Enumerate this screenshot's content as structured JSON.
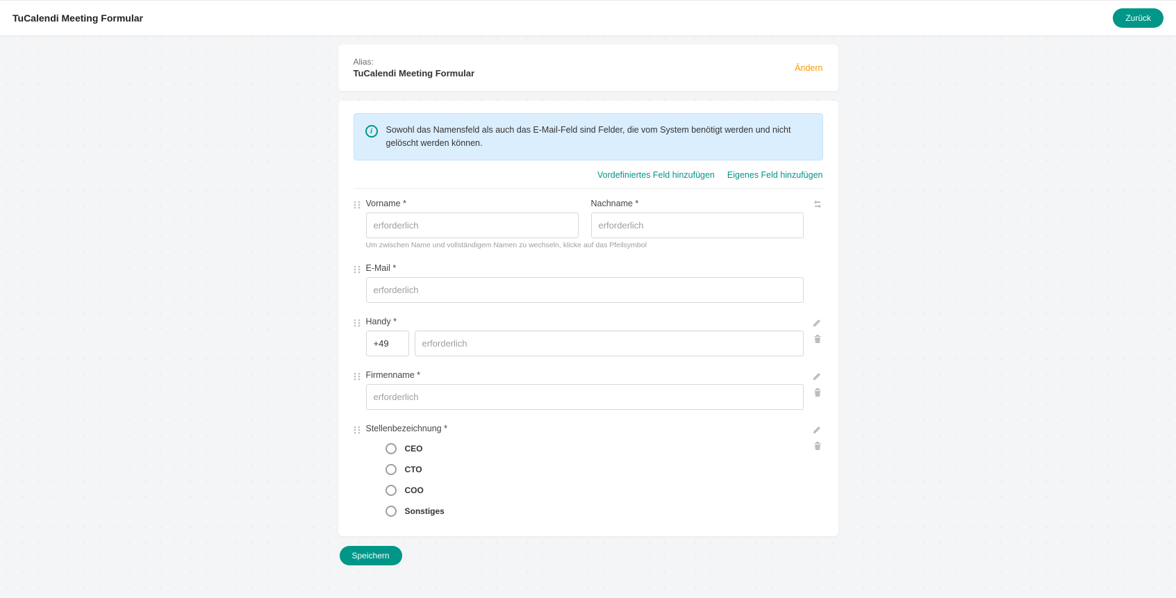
{
  "header": {
    "title": "TuCalendi Meeting Formular",
    "back_label": "Zurück"
  },
  "alias": {
    "label": "Alias:",
    "value": "TuCalendi Meeting Formular",
    "change_label": "Ändern"
  },
  "info": {
    "text": "Sowohl das Namensfeld als auch das E-Mail-Feld sind Felder, die vom System benötigt werden und nicht gelöscht werden können."
  },
  "actions": {
    "add_predefined": "Vordefiniertes Feld hinzufügen",
    "add_custom": "Eigenes Feld hinzufügen"
  },
  "fields": {
    "firstname": {
      "label": "Vorname *",
      "placeholder": "erforderlich"
    },
    "lastname": {
      "label": "Nachname *",
      "placeholder": "erforderlich"
    },
    "name_hint": "Um zwischen Name und vollständigem Namen zu wechseln, klicke auf das Pfeilsymbol",
    "email": {
      "label": "E-Mail *",
      "placeholder": "erforderlich"
    },
    "phone": {
      "label": "Handy *",
      "country_code": "+49",
      "placeholder": "erforderlich"
    },
    "company": {
      "label": "Firmenname *",
      "placeholder": "erforderlich"
    },
    "jobtitle": {
      "label": "Stellenbezeichnung *",
      "options": [
        "CEO",
        "CTO",
        "COO",
        "Sonstiges"
      ]
    }
  },
  "save_label": "Speichern"
}
